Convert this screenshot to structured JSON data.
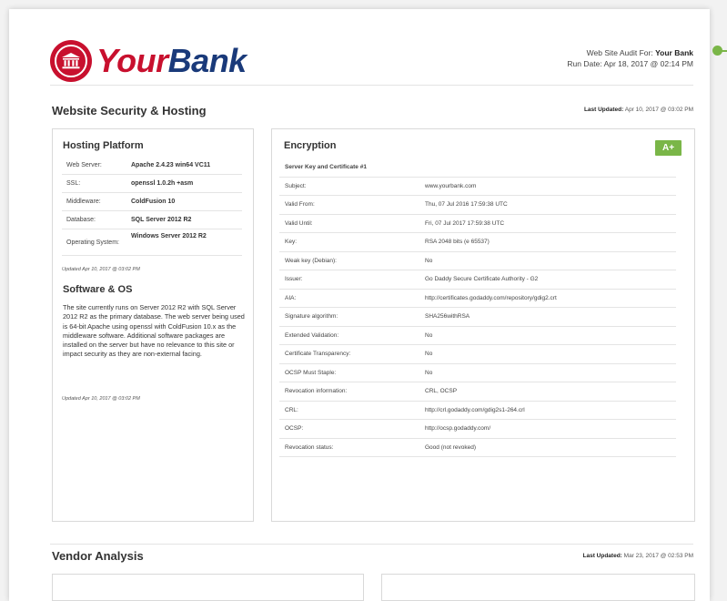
{
  "brand": {
    "name_part1": "Your",
    "name_part2": "Bank",
    "seal_icon": "bank-building-icon",
    "red": "#c8102e",
    "navy": "#1a3a7a"
  },
  "audit": {
    "for_label": "Web Site Audit For:",
    "for_value": "Your Bank",
    "run_date": "Run Date: Apr 18, 2017 @ 02:14 PM"
  },
  "security": {
    "title": "Website Security & Hosting",
    "updated_label": "Last Updated:",
    "updated_value": "Apr 10, 2017 @ 03:02 PM"
  },
  "hosting": {
    "title": "Hosting Platform",
    "rows": [
      {
        "key": "Web Server:",
        "value": "Apache 2.4.23 win64 VC11"
      },
      {
        "key": "SSL:",
        "value": "openssl 1.0.2h +asm"
      },
      {
        "key": "Middleware:",
        "value": "ColdFusion 10"
      },
      {
        "key": "Database:",
        "value": "SQL Server 2012 R2"
      },
      {
        "key": "Operating System:",
        "value": "Windows Server 2012 R2"
      }
    ],
    "updated_note": "Updated Apr 10, 2017 @ 03:02 PM"
  },
  "software": {
    "title": "Software & OS",
    "text": "The site currently runs on Server 2012 R2 with SQL Server 2012 R2 as the primary database. The web server being used is 64-bit Apache using openssl with ColdFusion 10.x as the middleware software. Additional software packages are installed on the server but have no relevance to this site or impact security as they are non-external facing.",
    "updated_note": "Updated Apr 10, 2017 @ 03:02 PM"
  },
  "encryption": {
    "title": "Encryption",
    "grade": "A+",
    "grade_color": "#7ab648",
    "table_heading": "Server Key and Certificate #1",
    "rows": [
      {
        "key": "Subject:",
        "value": "www.yourbank.com"
      },
      {
        "key": "Valid From:",
        "value": "Thu, 07 Jul 2016 17:59:38 UTC"
      },
      {
        "key": "Valid Until:",
        "value": "Fri, 07 Jul 2017 17:59:38 UTC"
      },
      {
        "key": "Key:",
        "value": "RSA 2048 bits (e 65537)"
      },
      {
        "key": "Weak key (Debian):",
        "value": "No"
      },
      {
        "key": "Issuer:",
        "value": "Go Daddy Secure Certificate Authority - G2"
      },
      {
        "key": "AIA:",
        "value": "http://certificates.godaddy.com/repository/gdig2.crt"
      },
      {
        "key": "Signature algorithm:",
        "value": "SHA256withRSA"
      },
      {
        "key": "Extended Validation:",
        "value": "No"
      },
      {
        "key": "Certificate Transparency:",
        "value": "No"
      },
      {
        "key": "OCSP Must Staple:",
        "value": "No"
      },
      {
        "key": "Revocation information:",
        "value": "CRL, OCSP"
      },
      {
        "key": "CRL:",
        "value": "http://crl.godaddy.com/gdig2s1-264.crl"
      },
      {
        "key": "OCSP:",
        "value": "http://ocsp.godaddy.com/"
      },
      {
        "key": "Revocation status:",
        "value": "Good (not revoked)"
      }
    ]
  },
  "vendor": {
    "title": "Vendor Analysis",
    "updated_label": "Last Updated:",
    "updated_value": "Mar 23, 2017 @ 02:53 PM"
  }
}
